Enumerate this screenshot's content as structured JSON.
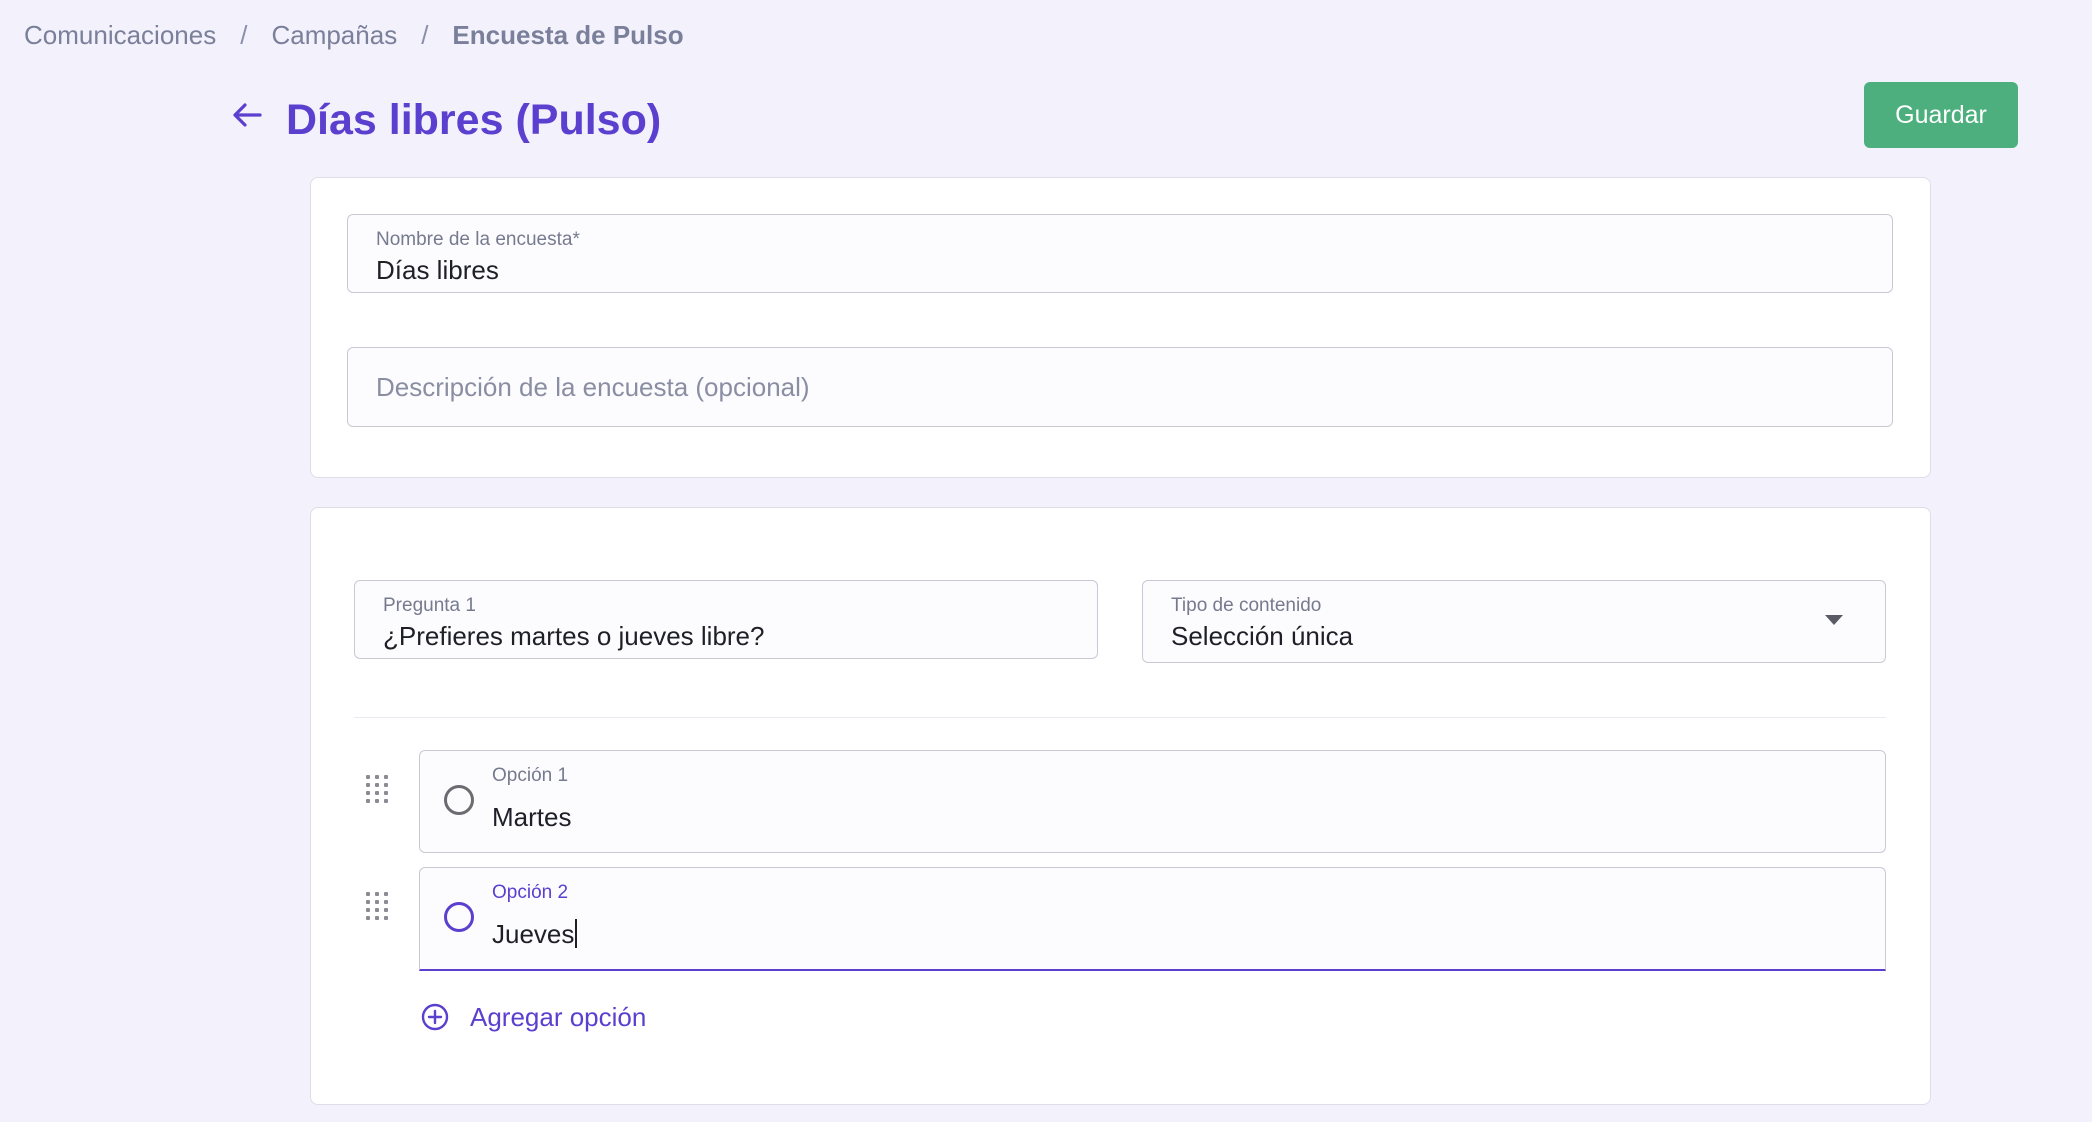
{
  "breadcrumb": {
    "items": [
      "Comunicaciones",
      "Campañas"
    ],
    "separator": "/",
    "current": "Encuesta de Pulso"
  },
  "header": {
    "title": "Días libres (Pulso)",
    "back_icon": "arrow-left-icon",
    "save_label": "Guardar"
  },
  "survey": {
    "name_label": "Nombre de la encuesta*",
    "name_value": "Días libres",
    "description_placeholder": "Descripción de la encuesta (opcional)"
  },
  "question": {
    "label": "Pregunta 1",
    "value": "¿Prefieres martes o jueves libre?",
    "type_label": "Tipo de contenido",
    "type_value": "Selección única",
    "options": [
      {
        "label": "Opción 1",
        "value": "Martes"
      },
      {
        "label": "Opción 2",
        "value": "Jueves"
      }
    ],
    "add_option_label": "Agregar opción"
  },
  "colors": {
    "accent": "#5b3fcf",
    "save_button": "#4caf7d",
    "background": "#f2f1fc"
  }
}
